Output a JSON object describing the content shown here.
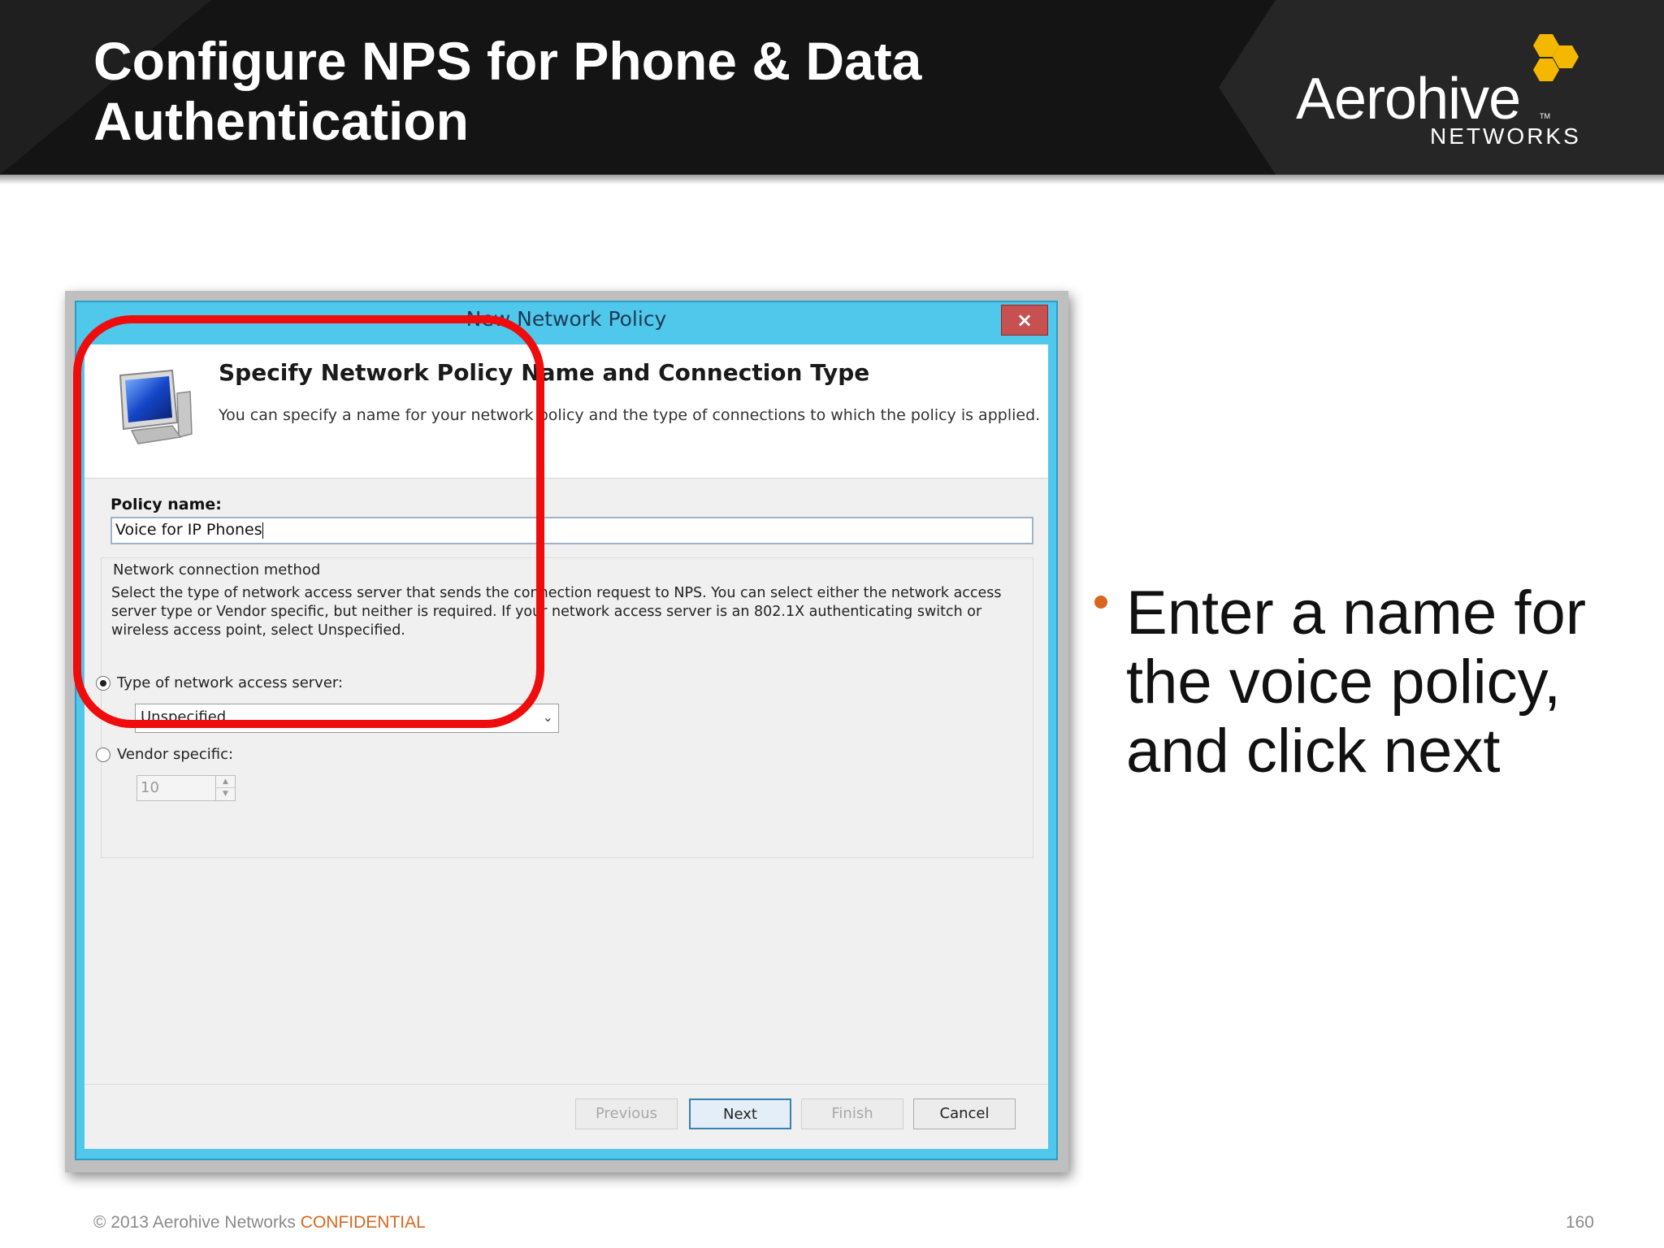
{
  "slide": {
    "title_line1": "Configure NPS for Phone & Data",
    "title_line2": "Authentication"
  },
  "logo": {
    "wordmark": "Aerohive",
    "trademark": "TM",
    "subline": "NETWORKS",
    "accent_color": "#f5b800"
  },
  "dialog": {
    "window_title": "New Network Policy",
    "close_glyph": "×",
    "heading": "Specify Network Policy Name and Connection Type",
    "subheading": "You can specify a name for your network policy and the type of connections to which the policy is applied.",
    "policy_name_label": "Policy name:",
    "policy_name_value": "Voice for IP Phones",
    "connection_group_label": "Network connection method",
    "connection_description": "Select the type of network access server that sends the connection request to NPS. You can select either the network access server type or Vendor specific, but neither is required.  If your network access server is an 802.1X authenticating switch or wireless access point, select Unspecified.",
    "radio_type_label": "Type of network access server:",
    "radio_type_selected": true,
    "server_type_value": "Unspecified",
    "radio_vendor_label": "Vendor specific:",
    "radio_vendor_selected": false,
    "vendor_value": "10",
    "buttons": {
      "previous": "Previous",
      "next": "Next",
      "finish": "Finish",
      "cancel": "Cancel"
    }
  },
  "bullet": {
    "text": "Enter a name for the voice policy, and click next",
    "bullet_color": "#d8661e"
  },
  "footer": {
    "copyright": "© 2013 Aerohive Networks ",
    "confidential": "CONFIDENTIAL",
    "page_number": "160"
  },
  "colors": {
    "header_bg": "#141414",
    "dialog_frame": "#4fc8ec",
    "highlight": "#ee0c0c"
  }
}
